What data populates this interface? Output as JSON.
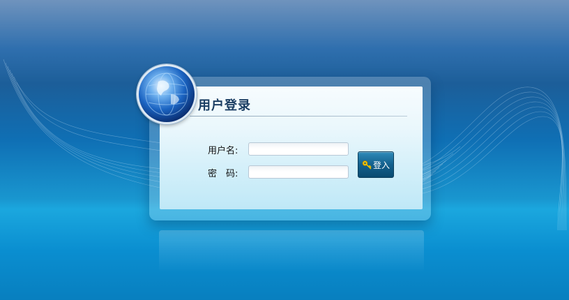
{
  "login": {
    "title": "用户登录",
    "username_label": "用户名:",
    "password_label": "密　码:",
    "username_value": "",
    "password_value": "",
    "submit_label": "登入"
  },
  "icons": {
    "globe": "globe-icon",
    "login_key": "key-icon"
  },
  "colors": {
    "title_text": "#1b3e63",
    "button": "#13608d",
    "background_top": "#6f93bd",
    "background_bottom": "#087fbf"
  }
}
